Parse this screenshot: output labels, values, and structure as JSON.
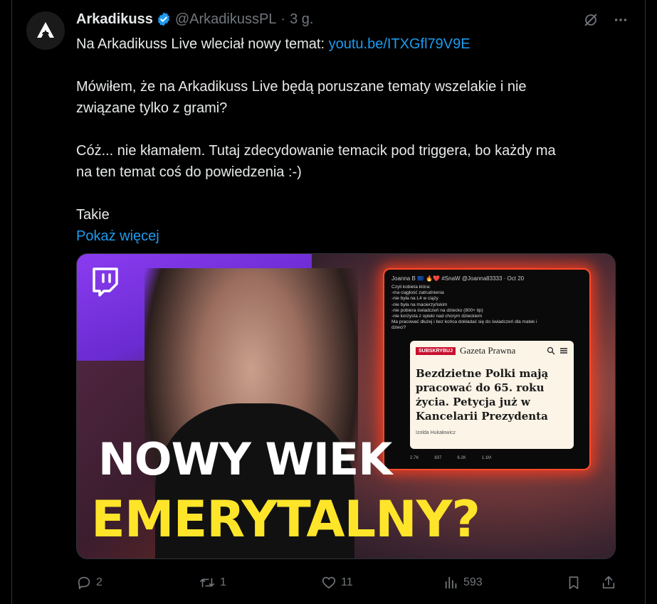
{
  "author": {
    "name": "Arkadikuss",
    "handle": "@ArkadikussPL",
    "separator": "·",
    "time": "3 g."
  },
  "tweet": {
    "line1_prefix": "Na Arkadikuss Live wleciał nowy temat: ",
    "line1_link": "youtu.be/ITXGfl79V9E",
    "para2_line1": "Mówiłem, że na Arkadikuss Live będą poruszane tematy wszelakie i nie",
    "para2_line2": "związane tylko z grami?",
    "para3_line1": "Cóż... nie kłamałem. Tutaj zdecydowanie temacik pod triggera, bo każdy ma",
    "para3_line2": "na ten temat coś do powiedzenia :-)",
    "para4": "Takie",
    "show_more": "Pokaż więcej"
  },
  "thumbnail": {
    "headline1": "NOWY WIEK",
    "headline2": "EMERYTALNY?",
    "embedded_post": {
      "header": "Joanna B 🇪🇺 🔥❤️ #SnaW @Joanna83333 · Oct 20",
      "lines": [
        "Czyli kobieta która:",
        "-ma ciągłość zatrudnienia",
        "-nie była na L4 w ciąży",
        "-nie była na macierzyńskim",
        "-nie pobiera świadczeń na dziecko (800+ itp)",
        "-nie korzysta z opieki nad chorym dzieckiem",
        "Ma pracować dłużej i bez końca dokładać się do świadczeń dla matek i",
        "dzieci?"
      ],
      "subscribe": "SUBSKRYBUJ",
      "paper": "Gazeta Prawna",
      "headline": "Bezdzietne Polki mają pracować do 65. roku życia. Petycja już w Kancelarii Prezydenta",
      "byline": "Izolda Hukałowicz",
      "stats": [
        "2.7K",
        "837",
        "6.2K",
        "1.1M"
      ]
    }
  },
  "actions": {
    "replies": "2",
    "reposts": "1",
    "likes": "11",
    "views": "593"
  },
  "colors": {
    "link": "#1d9bf0",
    "muted": "#71767b",
    "verified": "#1d9bf0",
    "headline_yellow": "#ffe52a"
  }
}
